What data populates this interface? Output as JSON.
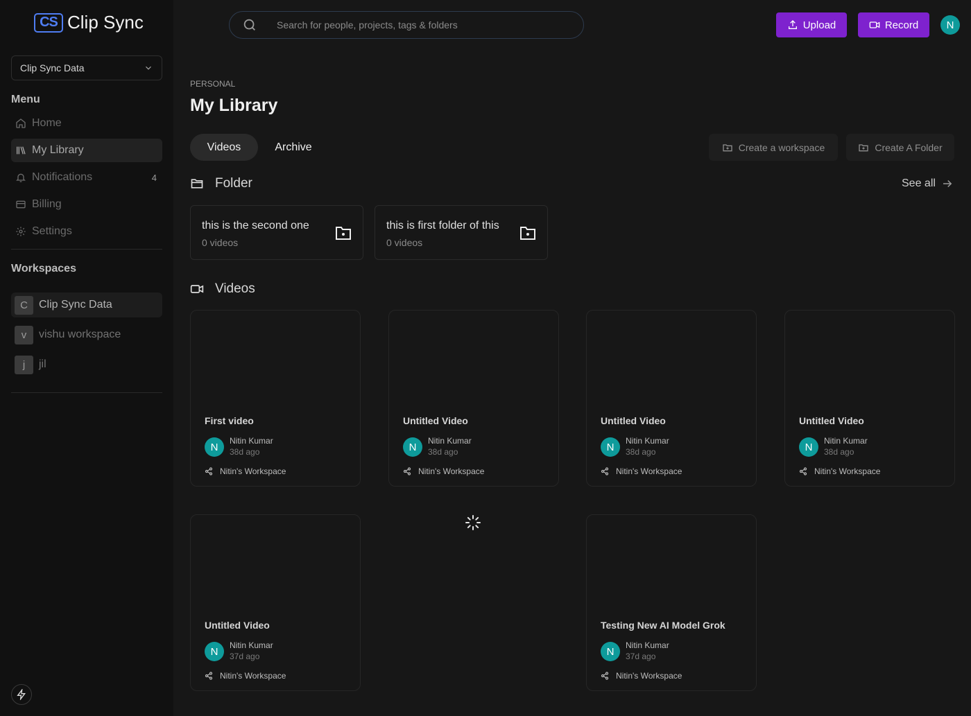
{
  "app": {
    "logo_mark": "CS",
    "logo_text": "Clip Sync"
  },
  "sidebar": {
    "workspace_select": "Clip Sync Data",
    "menu_title": "Menu",
    "items": [
      {
        "label": "Home",
        "icon": "home-icon"
      },
      {
        "label": "My Library",
        "icon": "library-icon"
      },
      {
        "label": "Notifications",
        "icon": "bell-icon",
        "count": "4"
      },
      {
        "label": "Billing",
        "icon": "credit-card-icon"
      },
      {
        "label": "Settings",
        "icon": "gear-icon"
      }
    ],
    "workspaces_title": "Workspaces",
    "workspaces": [
      {
        "initial": "C",
        "name": "Clip Sync Data"
      },
      {
        "initial": "v",
        "name": "vishu workspace"
      },
      {
        "initial": "j",
        "name": "jil"
      }
    ]
  },
  "header": {
    "search_placeholder": "Search for people, projects, tags & folders",
    "upload_label": "Upload",
    "record_label": "Record",
    "avatar_initial": "N"
  },
  "main": {
    "breadcrumb": "PERSONAL",
    "title": "My Library",
    "tabs": [
      {
        "label": "Videos"
      },
      {
        "label": "Archive"
      }
    ],
    "create_workspace_label": "Create a workspace",
    "create_folder_label": "Create A Folder",
    "folder_section_title": "Folder",
    "see_all_label": "See all",
    "folders": [
      {
        "name": "this is the second one",
        "count": "0 videos"
      },
      {
        "name": "this is first folder of this",
        "count": "0 videos"
      }
    ],
    "videos_section_title": "Videos",
    "videos": [
      {
        "title": "First video",
        "author": "Nitin Kumar",
        "avatar": "N",
        "time": "38d ago",
        "workspace": "Nitin's Workspace"
      },
      {
        "title": "Untitled Video",
        "author": "Nitin Kumar",
        "avatar": "N",
        "time": "38d ago",
        "workspace": "Nitin's Workspace"
      },
      {
        "title": "Untitled Video",
        "author": "Nitin Kumar",
        "avatar": "N",
        "time": "38d ago",
        "workspace": "Nitin's Workspace"
      },
      {
        "title": "Untitled Video",
        "author": "Nitin Kumar",
        "avatar": "N",
        "time": "38d ago",
        "workspace": "Nitin's Workspace"
      },
      {
        "title": "Untitled Video",
        "author": "Nitin Kumar",
        "avatar": "N",
        "time": "37d ago",
        "workspace": "Nitin's Workspace"
      },
      {
        "title": "Testing New AI Model Grok",
        "author": "Nitin Kumar",
        "avatar": "N",
        "time": "37d ago",
        "workspace": "Nitin's Workspace"
      }
    ]
  },
  "colors": {
    "accent": "#7e22ce",
    "avatar": "#0e9b9b",
    "logo": "#4f7df2"
  }
}
